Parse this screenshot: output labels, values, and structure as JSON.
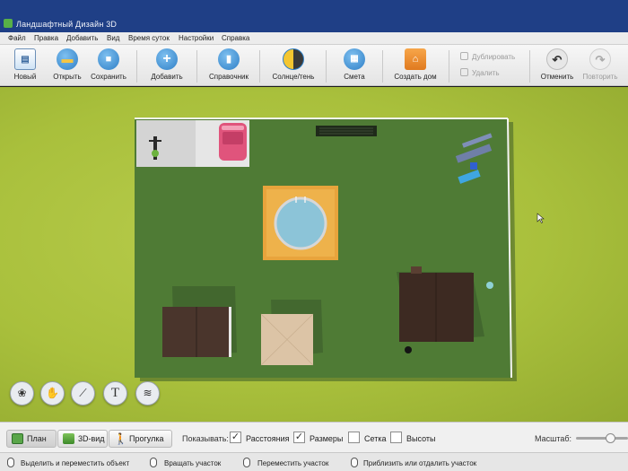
{
  "window": {
    "title": "Ландшафтный Дизайн 3D"
  },
  "menu": [
    "Файл",
    "Правка",
    "Добавить",
    "Вид",
    "Время суток",
    "Настройки",
    "Справка"
  ],
  "toolbar": {
    "new": "Новый",
    "open": "Открыть",
    "save": "Сохранить",
    "add": "Добавить",
    "reference": "Справочник",
    "sun_shadow": "Солнце/тень",
    "estimate": "Смета",
    "create_house": "Создать дом",
    "duplicate": "Дублировать",
    "delete": "Удалить",
    "undo": "Отменить",
    "redo": "Повторить"
  },
  "view_tabs": {
    "plan": "План",
    "view3d": "3D-вид",
    "walk": "Прогулка"
  },
  "show": {
    "label": "Показывать:",
    "options": [
      {
        "label": "Расстояния",
        "checked": true
      },
      {
        "label": "Размеры",
        "checked": true
      },
      {
        "label": "Сетка",
        "checked": false
      },
      {
        "label": "Высоты",
        "checked": false
      }
    ]
  },
  "zoom": {
    "label": "Масштаб:",
    "level": 0.7
  },
  "plan_tools": {
    "text_tool": "T"
  },
  "status": {
    "select_move": "Выделить и переместить объект",
    "rotate": "Вращать участок",
    "move": "Переместить участок",
    "zoom": "Приблизить или отдалить участок"
  },
  "colors": {
    "titlebar": "#1f3f86",
    "lawn_outside": "#a9c03c",
    "plot": "#4f7b35",
    "house": "#3d2a22",
    "deck": "#e8a43c",
    "pool": "#8cc4d8",
    "car": "#e0547c"
  },
  "icons": {
    "new": "document-icon",
    "open": "folder-icon",
    "save": "floppy-icon",
    "add": "plus-icon",
    "reference": "book-icon",
    "sun_shadow": "sun-moon-icon",
    "estimate": "calculator-icon",
    "create_house": "house-icon",
    "undo": "undo-icon",
    "redo": "redo-icon"
  }
}
